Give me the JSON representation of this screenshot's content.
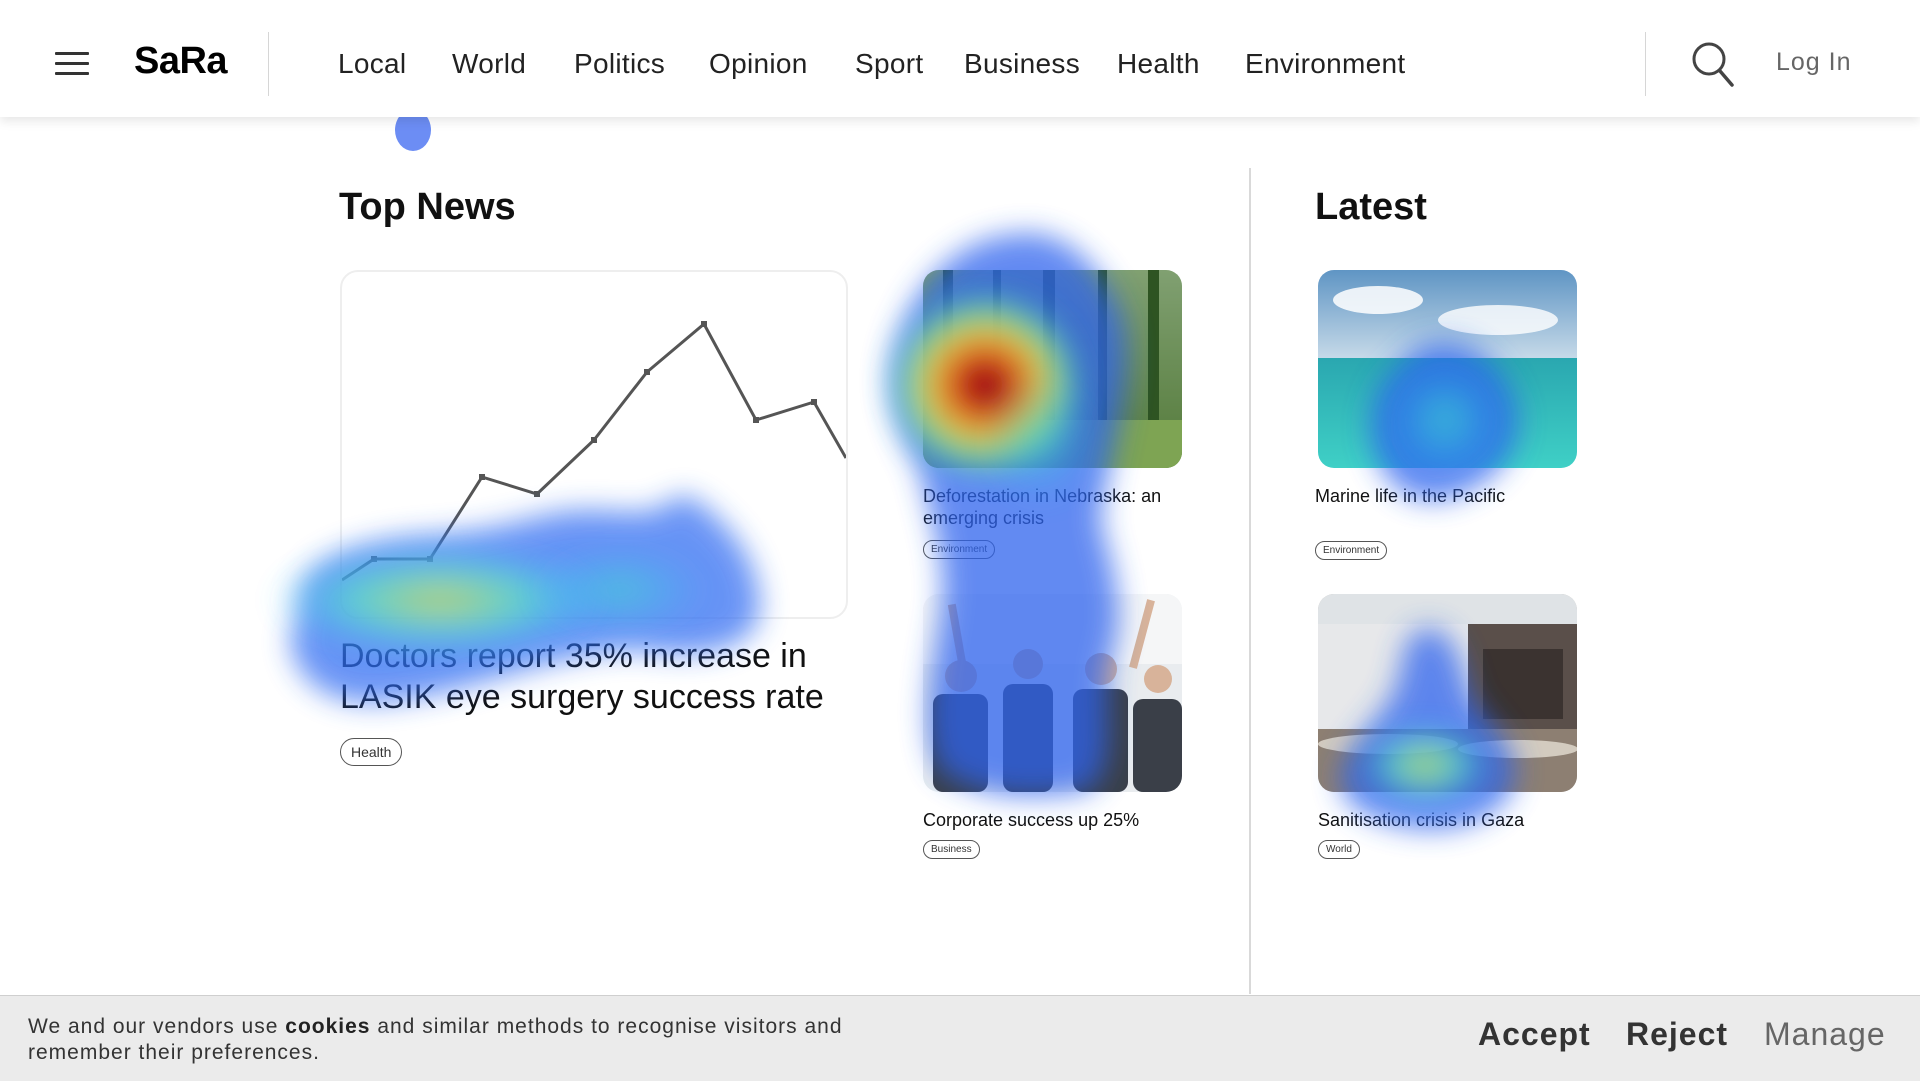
{
  "header": {
    "logo": "SaRa",
    "nav": [
      "Local",
      "World",
      "Politics",
      "Opinion",
      "Sport",
      "Business",
      "Health",
      "Environment"
    ],
    "login_label": "Log In"
  },
  "top_news": {
    "title": "Top News",
    "feature": {
      "headline": "Doctors report 35% increase in LASIK eye surgery success rate",
      "tag": "Health"
    },
    "cards": [
      {
        "headline": "Deforestation in Nebraska: an emerging crisis",
        "tag": "Environment"
      },
      {
        "headline": "Corporate success up 25%",
        "tag": "Business"
      }
    ]
  },
  "latest": {
    "title": "Latest",
    "cards": [
      {
        "headline": "Marine life in the Pacific",
        "tag": "Environment"
      },
      {
        "headline": "Sanitisation crisis in Gaza",
        "tag": "World"
      }
    ]
  },
  "cookie": {
    "text_before": "We and our vendors use ",
    "text_bold": "cookies",
    "text_after": " and similar methods to recognise visitors and remember their preferences.",
    "accept": "Accept",
    "reject": "Reject",
    "manage": "Manage"
  },
  "colors": {
    "accent_text": "#111111",
    "muted_text": "#666666",
    "cookie_bg": "#ebebeb",
    "divider": "#d9d9d9"
  }
}
